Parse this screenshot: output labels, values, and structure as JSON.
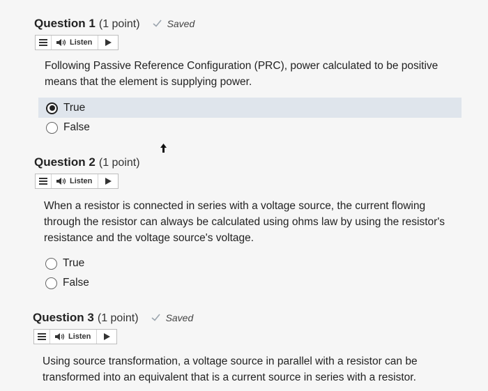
{
  "questions": [
    {
      "title": "Question 1",
      "points": "(1 point)",
      "saved": "Saved",
      "listen": "Listen",
      "text": "Following Passive Reference Configuration (PRC), power calculated to be positive means that the element is supplying power.",
      "options": [
        {
          "label": "True",
          "selected": true
        },
        {
          "label": "False",
          "selected": false
        }
      ]
    },
    {
      "title": "Question 2",
      "points": "(1 point)",
      "listen": "Listen",
      "text": "When a resistor is connected in series with a voltage source, the current flowing through the resistor can always be calculated using ohms law by using the resistor's resistance and the voltage source's voltage.",
      "options": [
        {
          "label": "True",
          "selected": false
        },
        {
          "label": "False",
          "selected": false
        }
      ]
    },
    {
      "title": "Question 3",
      "points": "(1 point)",
      "saved": "Saved",
      "listen": "Listen",
      "text": "Using source transformation, a voltage source in parallel with a resistor can be transformed into an equivalent that is a current source in series with a resistor."
    }
  ],
  "colors": {
    "selected_option_bg": "#dfe5ec",
    "check": "#9aa4ad",
    "background": "#f6f6f6"
  },
  "icons": [
    "check-icon",
    "menu-icon",
    "speaker-icon",
    "play-icon",
    "cursor-icon"
  ]
}
